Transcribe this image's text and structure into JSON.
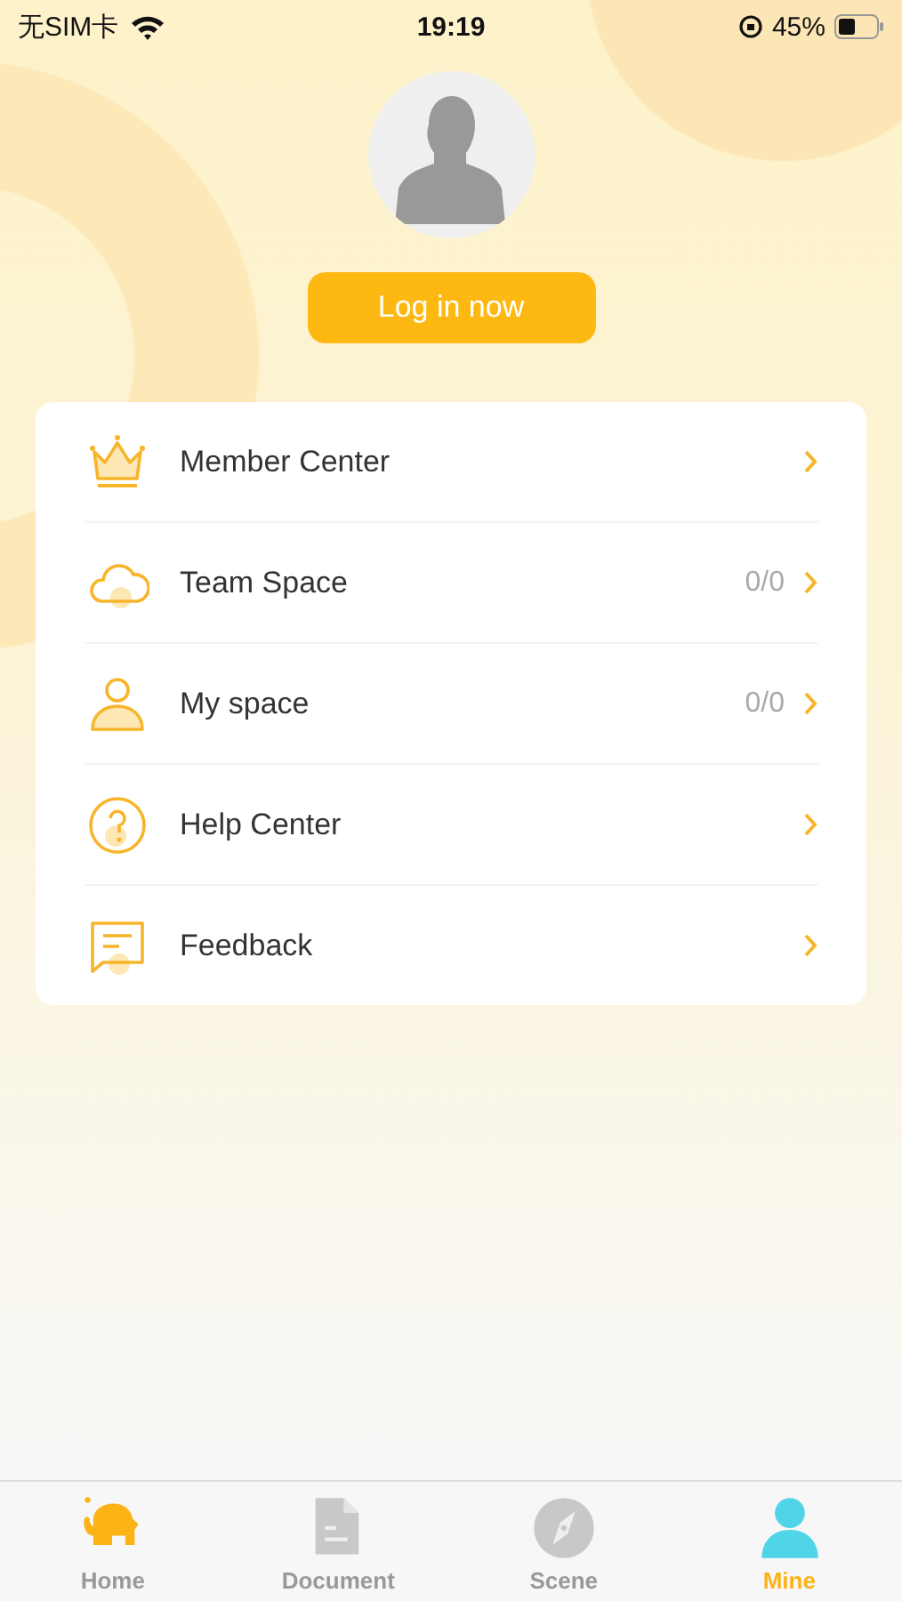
{
  "status_bar": {
    "carrier": "无SIM卡",
    "time": "19:19",
    "battery": "45%"
  },
  "profile": {
    "login_button": "Log in now"
  },
  "menu": [
    {
      "kind": "member",
      "label": "Member Center"
    },
    {
      "kind": "team",
      "label": "Team Space",
      "count": "0/0"
    },
    {
      "kind": "space",
      "label": "My space",
      "count": "0/0"
    },
    {
      "kind": "help",
      "label": "Help Center"
    },
    {
      "kind": "feedback",
      "label": "Feedback"
    }
  ],
  "tab_bar": [
    {
      "kind": "home",
      "label": "Home",
      "selected": false
    },
    {
      "kind": "document",
      "label": "Document",
      "selected": false
    },
    {
      "kind": "scene",
      "label": "Scene",
      "selected": false
    },
    {
      "kind": "mine",
      "label": "Mine",
      "selected": true
    }
  ]
}
